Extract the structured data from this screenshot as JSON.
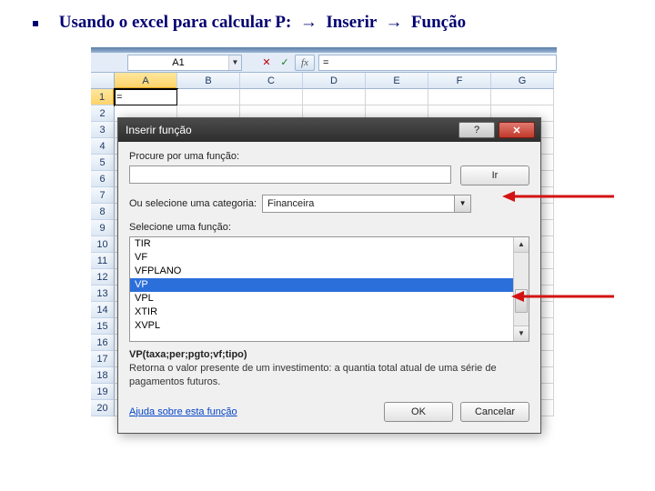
{
  "slide": {
    "bullet_text": "Usando o excel para calcular  P:",
    "arrow1": "→",
    "step1": "Inserir",
    "arrow2": "→",
    "step2": "Função"
  },
  "excel": {
    "name_box": "A1",
    "fx_cancel": "✕",
    "fx_enter": "✓",
    "fx_label": "fx",
    "formula": "=",
    "columns": [
      "A",
      "B",
      "C",
      "D",
      "E",
      "F",
      "G"
    ],
    "rows": [
      "1",
      "2",
      "3",
      "4",
      "5",
      "6",
      "7",
      "8",
      "9",
      "10",
      "11",
      "12",
      "13",
      "14",
      "15",
      "16",
      "17",
      "18",
      "19",
      "20"
    ],
    "cell_a1": "="
  },
  "dialog": {
    "title": "Inserir função",
    "help_icon": "?",
    "close_icon": "✕",
    "search_label": "Procure por uma função:",
    "search_value": "",
    "go_label": "Ir",
    "category_label": "Ou selecione uma categoria:",
    "category_value": "Financeira",
    "select_label": "Selecione uma função:",
    "functions": [
      "TIR",
      "VF",
      "VFPLANO",
      "VP",
      "VPL",
      "XTIR",
      "XVPL"
    ],
    "selected_index": 3,
    "signature": "VP(taxa;per;pgto;vf;tipo)",
    "description": "Retorna o valor presente de um investimento: a quantia total atual de uma série de pagamentos futuros.",
    "help_link": "Ajuda sobre esta função",
    "ok": "OK",
    "cancel": "Cancelar"
  }
}
